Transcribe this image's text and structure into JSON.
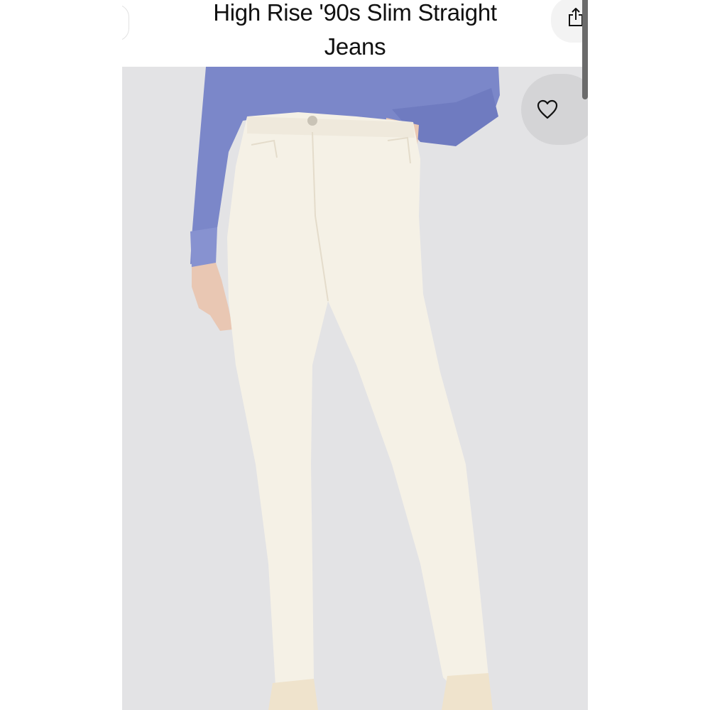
{
  "product": {
    "title_line1": "High Rise '90s Slim Straight",
    "title_line2": "Jeans"
  },
  "header": {
    "back_icon": "back-icon",
    "share_icon": "share-icon"
  },
  "image": {
    "alt": "Model wearing white high rise '90s slim straight jeans with a blue sweatshirt"
  },
  "favorite": {
    "icon": "heart-outline-icon"
  },
  "colors": {
    "background": "#e3e3e5",
    "sweatshirt": "#7b87c9",
    "jeans": "#f5f1e6",
    "text": "#111111"
  }
}
